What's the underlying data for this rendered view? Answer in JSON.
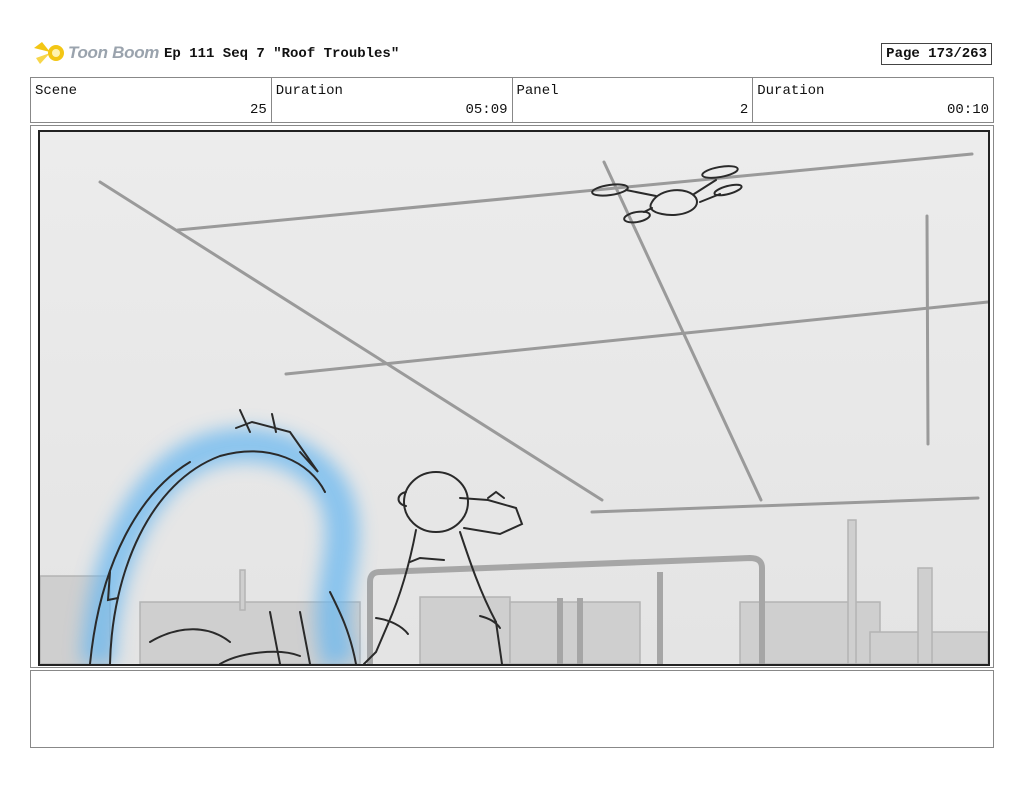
{
  "header": {
    "brand": "Toon Boom",
    "title": "Ep 111 Seq 7 \"Roof Troubles\"",
    "page": "Page 173/263"
  },
  "info": {
    "scene_label": "Scene",
    "scene_value": "25",
    "duration_label": "Duration",
    "duration_value": "05:09",
    "panel_label": "Panel",
    "panel_value": "2",
    "panel_duration_label": "Duration",
    "panel_duration_value": "00:10"
  },
  "colors": {
    "glow": "#6ab8f0",
    "logo_yellow": "#f3c614",
    "sketch": "#2a2a2a"
  },
  "icons": {
    "logo": "toon-boom-star-icon"
  }
}
